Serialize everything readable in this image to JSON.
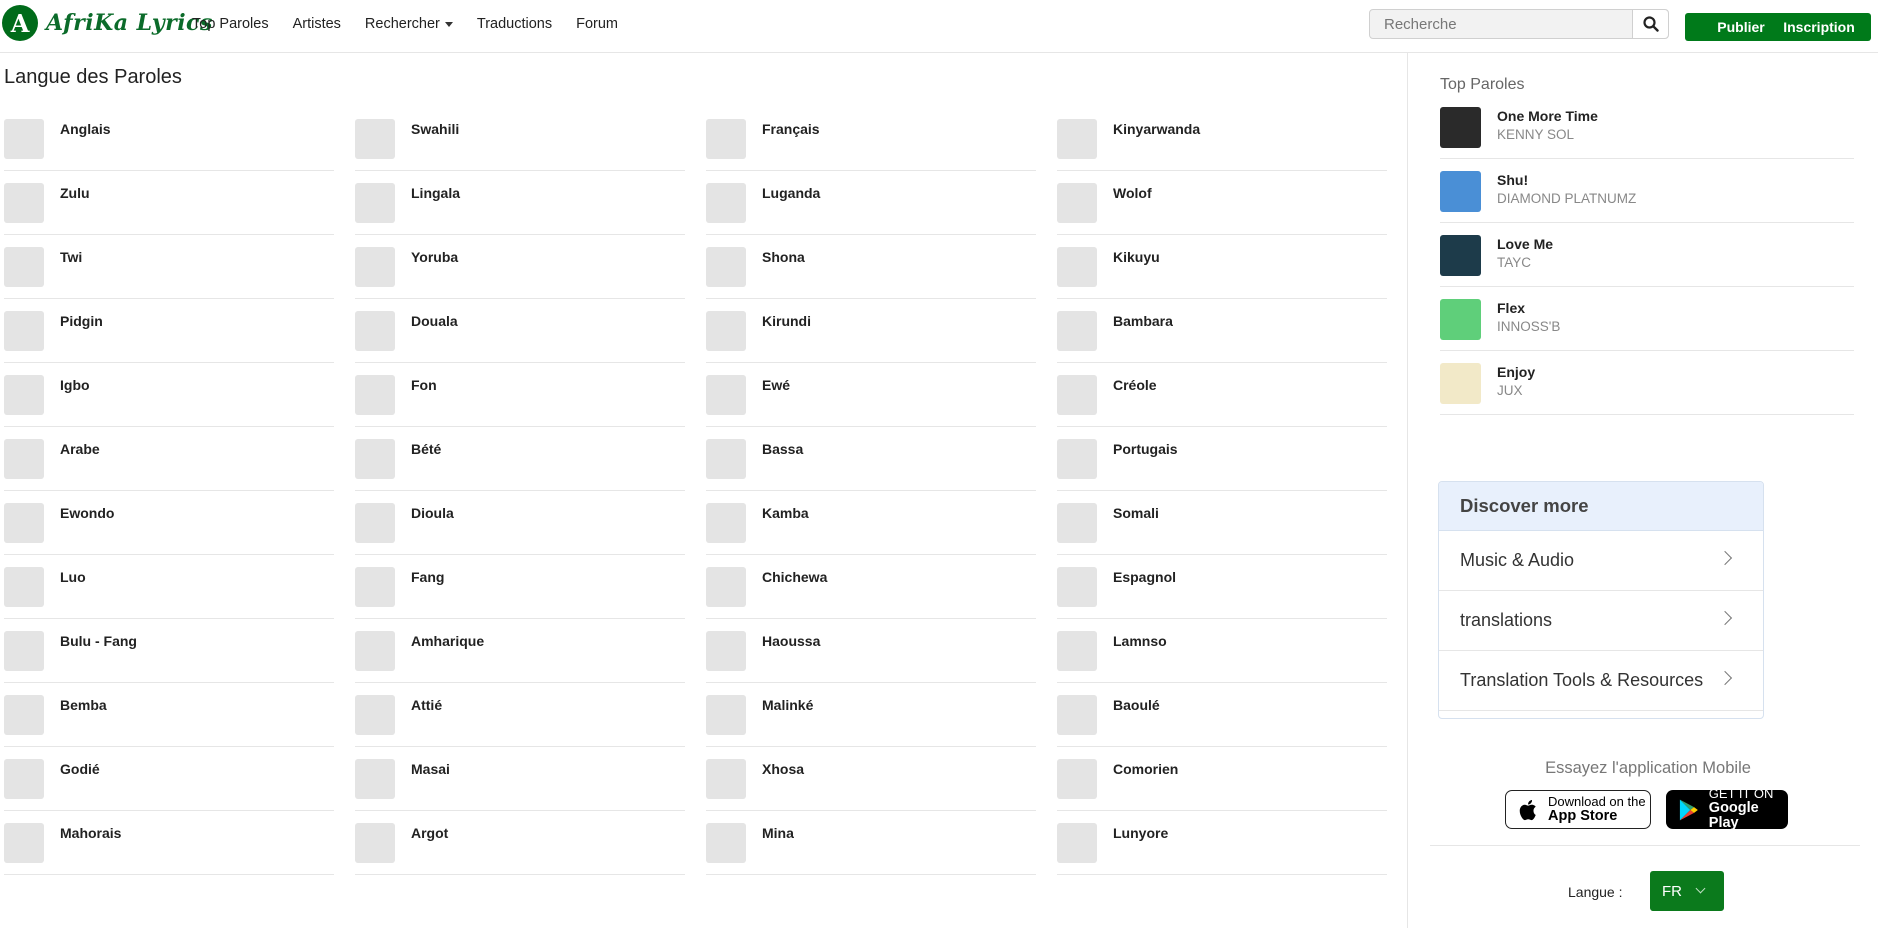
{
  "header": {
    "logo_letter": "A",
    "logo_text": "AfriKa Lyrics",
    "nav": [
      "Top Paroles",
      "Artistes",
      "Rechercher",
      "Traductions",
      "Forum"
    ],
    "search_placeholder": "Recherche",
    "publish_label": "Publier",
    "signup_label": "Inscription",
    "brand_color": "#007a1a"
  },
  "main": {
    "title": "Langue des Paroles",
    "languages": [
      [
        "Anglais",
        "Swahili",
        "Français",
        "Kinyarwanda"
      ],
      [
        "Zulu",
        "Lingala",
        "Luganda",
        "Wolof"
      ],
      [
        "Twi",
        "Yoruba",
        "Shona",
        "Kikuyu"
      ],
      [
        "Pidgin",
        "Douala",
        "Kirundi",
        "Bambara"
      ],
      [
        "Igbo",
        "Fon",
        "Ewé",
        "Créole"
      ],
      [
        "Arabe",
        "Bété",
        "Bassa",
        "Portugais"
      ],
      [
        "Ewondo",
        "Dioula",
        "Kamba",
        "Somali"
      ],
      [
        "Luo",
        "Fang",
        "Chichewa",
        "Espagnol"
      ],
      [
        "Bulu - Fang",
        "Amharique",
        "Haoussa",
        "Lamnso"
      ],
      [
        "Bemba",
        "Attié",
        "Malinké",
        "Baoulé"
      ],
      [
        "Godié",
        "Masai",
        "Xhosa",
        "Comorien"
      ],
      [
        "Mahorais",
        "Argot",
        "Mina",
        "Lunyore"
      ]
    ]
  },
  "sidebar": {
    "top_title": "Top Paroles",
    "top_items": [
      {
        "song": "One More Time",
        "artist": "KENNY SOL",
        "thumb_color": "#2a2a2a"
      },
      {
        "song": "Shu!",
        "artist": "DIAMOND PLATNUMZ",
        "thumb_color": "#4a8fd6"
      },
      {
        "song": "Love Me",
        "artist": "TAYC",
        "thumb_color": "#1d3b4a"
      },
      {
        "song": "Flex",
        "artist": "INNOSS'B",
        "thumb_color": "#5fcf7a"
      },
      {
        "song": "Enjoy",
        "artist": "JUX",
        "thumb_color": "#f2e9c8"
      }
    ],
    "discover_title": "Discover more",
    "discover_items": [
      "Music & Audio",
      "translations",
      "Translation Tools & Resources"
    ],
    "app_title": "Essayez l'application Mobile",
    "appstore_small": "Download on the",
    "appstore_big": "App Store",
    "gplay_small": "GET IT ON",
    "gplay_big": "Google Play",
    "language_label": "Langue :",
    "language_value": "FR"
  }
}
